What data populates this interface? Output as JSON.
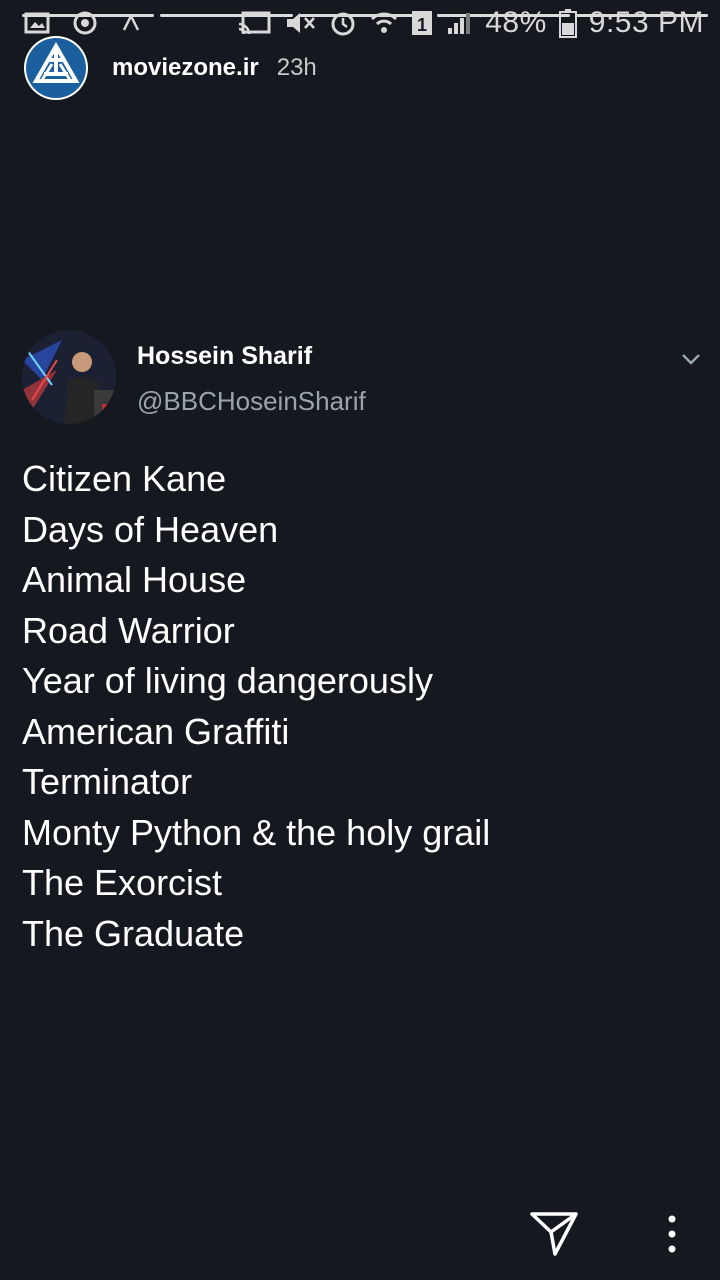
{
  "status_bar": {
    "battery_percent": "48%",
    "time": "9:53 PM",
    "icons": [
      "image-icon",
      "record-icon",
      "upload-icon",
      "cast-icon",
      "mute-icon",
      "alarm-icon",
      "wifi-icon",
      "sim-icon",
      "signal-icon",
      "battery-icon"
    ]
  },
  "story": {
    "account_name": "moviezone.ir",
    "time_ago": "23h",
    "progress_segments": 5
  },
  "tweet": {
    "author_name": "Hossein Sharif",
    "author_handle": "@BBCHoseinSharif",
    "lines": [
      "Citizen Kane",
      "Days of Heaven",
      "Animal House",
      "Road Warrior",
      "Year of living dangerously",
      "American Graffiti",
      "Terminator",
      "Monty Python & the holy grail",
      "The Exorcist",
      "The Graduate"
    ]
  },
  "colors": {
    "background": "#15181f",
    "brand_blue": "#1c5f9e",
    "handle_gray": "#9aa4ad"
  }
}
